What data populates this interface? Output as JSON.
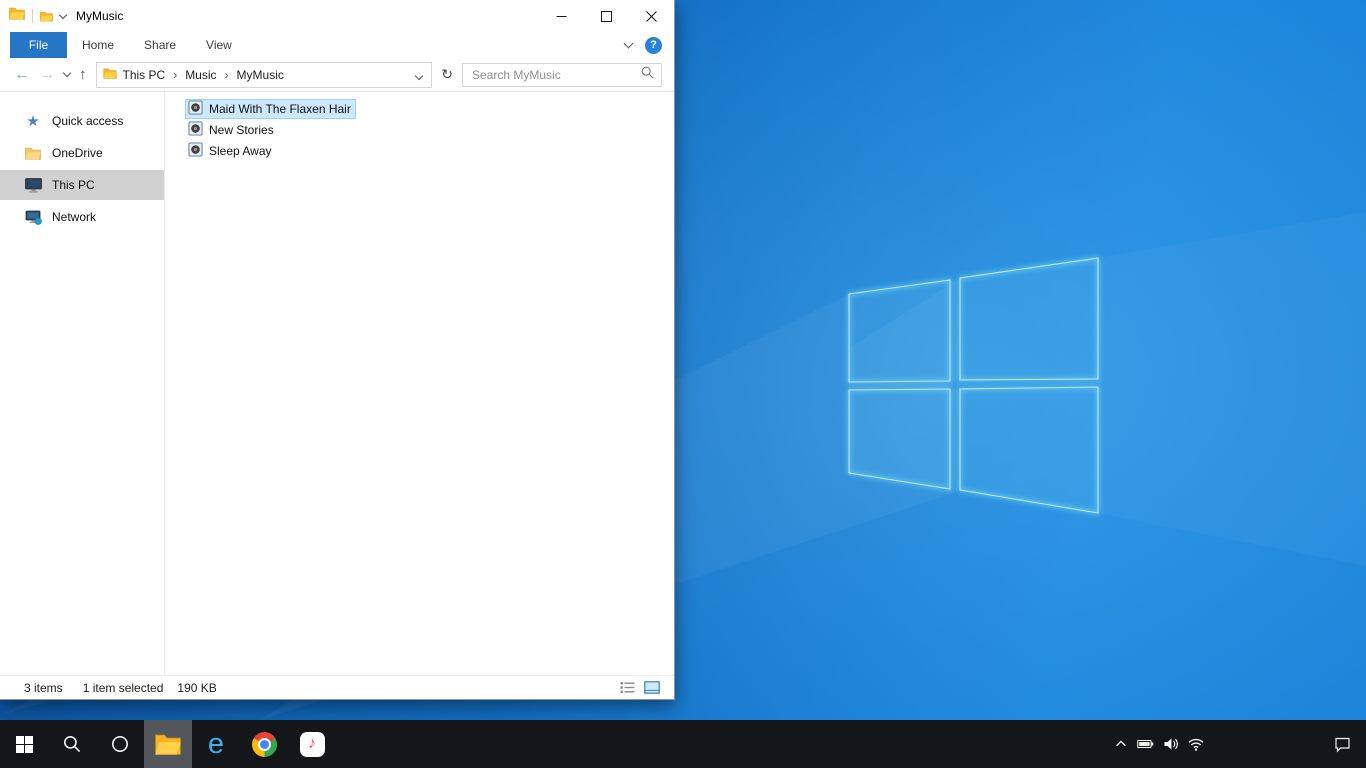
{
  "colors": {
    "accent_blue": "#2776c6",
    "selection_fill": "#cce8ff",
    "selection_border": "#99d1ff",
    "sidebar_selected": "#d1d1d1",
    "taskbar_bg": "#141619",
    "wallpaper_blue": "#1474c9"
  },
  "icons": {
    "star": "★",
    "back_arrow": "←",
    "forward_arrow": "→",
    "up_arrow": "↑",
    "refresh": "↻",
    "crumb_separator": "›",
    "help": "?",
    "ie_glyph": "e",
    "itunes_note": "♪"
  },
  "explorer": {
    "title": "MyMusic",
    "ribbon_tabs": [
      {
        "label": "File",
        "active": true
      },
      {
        "label": "Home",
        "active": false
      },
      {
        "label": "Share",
        "active": false
      },
      {
        "label": "View",
        "active": false
      }
    ],
    "address": {
      "breadcrumb": [
        "This PC",
        "Music",
        "MyMusic"
      ],
      "search_placeholder": "Search MyMusic"
    },
    "sidebar_items": [
      {
        "label": "Quick access",
        "icon": "star-icon",
        "selected": false
      },
      {
        "label": "OneDrive",
        "icon": "onedrive-folder-icon",
        "selected": false
      },
      {
        "label": "This PC",
        "icon": "computer-icon",
        "selected": true
      },
      {
        "label": "Network",
        "icon": "network-icon",
        "selected": false
      }
    ],
    "files": [
      {
        "name": "Maid With The Flaxen Hair",
        "type": "audio",
        "selected": true
      },
      {
        "name": "New Stories",
        "type": "audio",
        "selected": false
      },
      {
        "name": "Sleep Away",
        "type": "audio",
        "selected": false
      }
    ],
    "status_bar": {
      "item_count": "3 items",
      "selection": "1 item selected",
      "selection_size": "190 KB"
    }
  },
  "taskbar": {
    "buttons": [
      "start",
      "search",
      "cortana",
      "file-explorer",
      "internet-explorer",
      "chrome",
      "itunes"
    ],
    "active_button": "file-explorer",
    "tray": [
      "show-hidden-icons",
      "battery",
      "volume",
      "network",
      "action-center"
    ]
  }
}
